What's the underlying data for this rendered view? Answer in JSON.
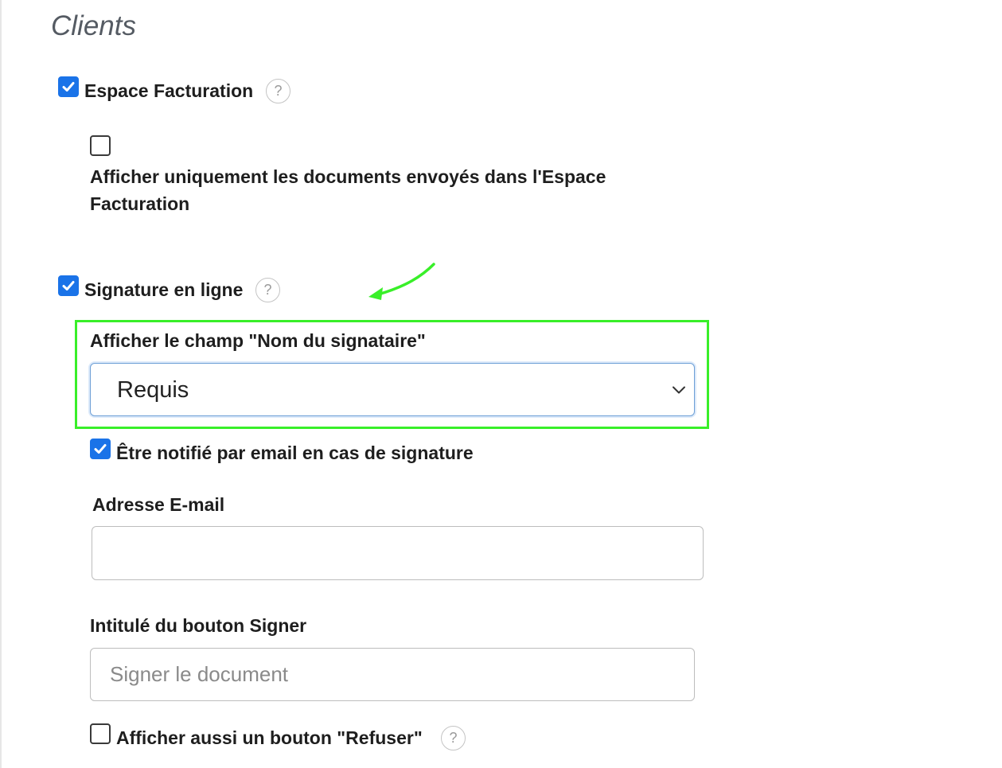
{
  "section": {
    "title": "Clients"
  },
  "espace_facturation": {
    "label": "Espace Facturation",
    "checked": true,
    "help": "?"
  },
  "only_sent_docs": {
    "label": "Afficher uniquement les documents envoyés dans l'Espace Facturation",
    "checked": false
  },
  "signature": {
    "label": "Signature en ligne",
    "checked": true,
    "help": "?"
  },
  "signer_name_field": {
    "label": "Afficher le champ \"Nom du signataire\"",
    "selected": "Requis"
  },
  "notify": {
    "label": "Être notifié par email en cas de signature",
    "checked": true
  },
  "email": {
    "label": "Adresse E-mail",
    "value": ""
  },
  "sign_button": {
    "label": "Intitulé du bouton Signer",
    "placeholder": "Signer le document"
  },
  "refuse": {
    "label": "Afficher aussi un bouton \"Refuser\"",
    "checked": false,
    "help": "?"
  },
  "colors": {
    "accent": "#1a73e8",
    "highlight": "#39ef29",
    "focus_border": "#6d9fd6"
  },
  "icons": [
    "check-icon",
    "help-icon",
    "chevron-down-icon",
    "annotation-arrow-icon"
  ]
}
